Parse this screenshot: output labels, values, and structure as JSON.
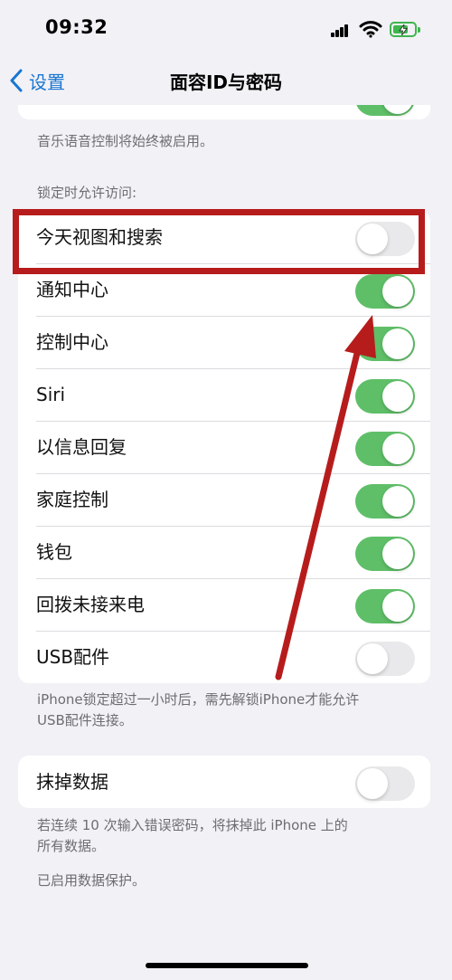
{
  "status_bar": {
    "time": "09:32"
  },
  "nav": {
    "back_label": "设置",
    "title": "面容ID与密码"
  },
  "top_group": {
    "footnote": "音乐语音控制将始终被启用。"
  },
  "locked_section": {
    "header": "锁定时允许访问:",
    "rows": [
      {
        "label": "今天视图和搜索",
        "on": false
      },
      {
        "label": "通知中心",
        "on": true
      },
      {
        "label": "控制中心",
        "on": true
      },
      {
        "label": "Siri",
        "on": true
      },
      {
        "label": "以信息回复",
        "on": true
      },
      {
        "label": "家庭控制",
        "on": true
      },
      {
        "label": "钱包",
        "on": true
      },
      {
        "label": "回拨未接来电",
        "on": true
      },
      {
        "label": "USB配件",
        "on": false
      }
    ],
    "footnote_line1": "iPhone锁定超过一小时后，需先解锁iPhone才能允许",
    "footnote_line2": "USB配件连接。"
  },
  "erase_section": {
    "label": "抹掉数据",
    "on": false,
    "footnote_line1": "若连续 10 次输入错误密码，将抹掉此 iPhone 上的",
    "footnote_line2": "所有数据。",
    "protection": "已启用数据保护。"
  },
  "colors": {
    "accent": "#1976d2",
    "toggle_on": "#5fbf68",
    "annotation": "#b71c1c",
    "background": "#f2f1f6"
  }
}
